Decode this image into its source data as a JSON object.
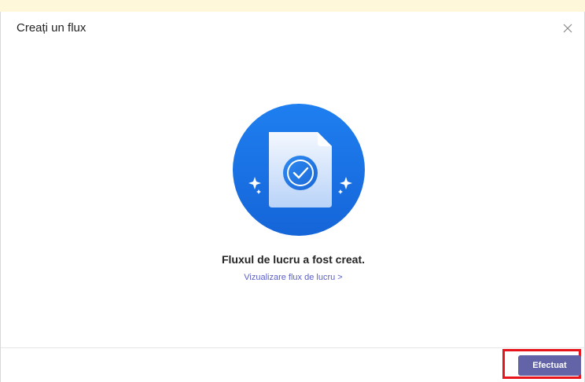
{
  "dialog": {
    "title": "Creați un flux",
    "close_icon": "close-icon"
  },
  "illustration": {
    "icon": "document-checkmark-icon",
    "circle_color": "#1a73e8"
  },
  "content": {
    "success_message": "Fluxul de lucru a fost creat.",
    "view_link_label": "Vizualizare flux de lucru >"
  },
  "footer": {
    "done_label": "Efectuat",
    "accent_color": "#6264a7",
    "highlight_color": "#e8141c"
  }
}
